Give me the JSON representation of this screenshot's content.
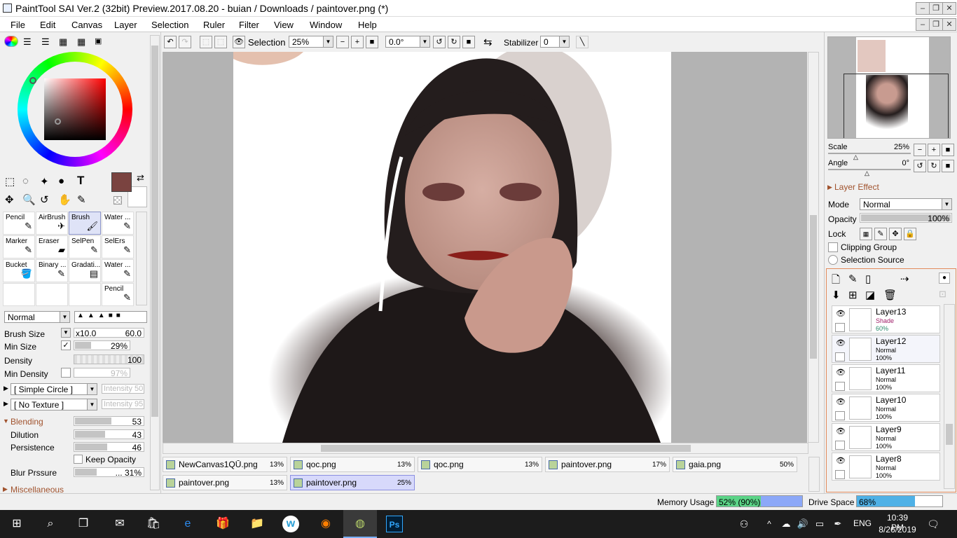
{
  "window": {
    "title": "PaintTool SAI Ver.2 (32bit) Preview.2017.08.20 - buian / Downloads / paintover.png (*)"
  },
  "menu": [
    "File",
    "Edit",
    "Canvas",
    "Layer",
    "Selection",
    "Ruler",
    "Filter",
    "View",
    "Window",
    "Help"
  ],
  "toolbar": {
    "selection_label": "Selection",
    "zoom_value": "25%",
    "angle_value": "0.0°",
    "stabilizer_label": "Stabilizer",
    "stabilizer_value": "0"
  },
  "tools": {
    "grid": [
      {
        "label": "Pencil",
        "icon": "✎"
      },
      {
        "label": "AirBrush",
        "icon": "✈"
      },
      {
        "label": "Brush",
        "icon": "🖌",
        "selected": true
      },
      {
        "label": "Water ...",
        "icon": "✎"
      },
      {
        "label": "Marker",
        "icon": "✎"
      },
      {
        "label": "Eraser",
        "icon": "▰"
      },
      {
        "label": "SelPen",
        "icon": "✎"
      },
      {
        "label": "SelErs",
        "icon": "✎"
      },
      {
        "label": "Bucket",
        "icon": "🪣"
      },
      {
        "label": "Binary ...",
        "icon": "✎"
      },
      {
        "label": "Gradati...",
        "icon": "▤"
      },
      {
        "label": "Water ...",
        "icon": "✎"
      },
      {
        "label": "",
        "icon": ""
      },
      {
        "label": "",
        "icon": ""
      },
      {
        "label": "",
        "icon": ""
      },
      {
        "label": "Pencil",
        "icon": "✎"
      }
    ]
  },
  "brush": {
    "blend_mode": "Normal",
    "size_label": "Brush Size",
    "size_mult": "x10.0",
    "size_value": "60.0",
    "min_size_label": "Min Size",
    "min_size_value": "29%",
    "min_size_fill": 0.29,
    "density_label": "Density",
    "density_value": "100",
    "min_density_label": "Min Density",
    "min_density_value": "97%",
    "shape": "[ Simple Circle ]",
    "shape_intensity": "Intensity 50",
    "texture": "[ No Texture ]",
    "texture_intensity": "Intensity 95",
    "blending_label": "Blending",
    "blending_value": "53",
    "blending_fill": 0.53,
    "dilution_label": "Dilution",
    "dilution_value": "43",
    "dilution_fill": 0.43,
    "persistence_label": "Persistence",
    "persistence_value": "46",
    "persistence_fill": 0.46,
    "keep_opacity_label": "Keep Opacity",
    "blur_label": "Blur Prssure",
    "blur_value": "... 31%",
    "blur_fill": 0.31,
    "misc_label": "Miscellaneous"
  },
  "colors": {
    "primary": "#7a4340",
    "accent_select": "#dfe3f7",
    "doctab_sel": "#d7d9fb"
  },
  "doc_tabs": [
    {
      "name": "NewCanvas1QŪ.png",
      "pct": "13%"
    },
    {
      "name": "qoc.png",
      "pct": "13%"
    },
    {
      "name": "qoc.png",
      "pct": "13%"
    },
    {
      "name": "paintover.png",
      "pct": "17%"
    },
    {
      "name": "gaia.png",
      "pct": "50%"
    },
    {
      "name": "paintover.png",
      "pct": "13%"
    },
    {
      "name": "paintover.png",
      "pct": "25%",
      "selected": true
    }
  ],
  "navigator": {
    "scale_label": "Scale",
    "scale_value": "25%",
    "angle_label": "Angle",
    "angle_value": "0°"
  },
  "layer_panel": {
    "effect_label": "Layer Effect",
    "mode_label": "Mode",
    "mode_value": "Normal",
    "opacity_label": "Opacity",
    "opacity_value": "100%",
    "lock_label": "Lock",
    "clipping_label": "Clipping Group",
    "selection_source_label": "Selection Source",
    "layers": [
      {
        "name": "Layer13",
        "mode": "Shade",
        "opacity": "60%"
      },
      {
        "name": "Layer12",
        "mode": "Normal",
        "opacity": "100%"
      },
      {
        "name": "Layer11",
        "mode": "Normal",
        "opacity": "100%"
      },
      {
        "name": "Layer10",
        "mode": "Normal",
        "opacity": "100%"
      },
      {
        "name": "Layer9",
        "mode": "Normal",
        "opacity": "100%"
      },
      {
        "name": "Layer8",
        "mode": "Normal",
        "opacity": "100%"
      }
    ]
  },
  "status": {
    "memory_label": "Memory Usage",
    "memory_value": "52% (90%)",
    "memory_fill": 0.52,
    "drive_label": "Drive Space",
    "drive_value": "68%",
    "drive_fill": 0.68
  },
  "taskbar": {
    "lang": "ENG",
    "time": "10:39 PM",
    "date": "8/26/2019"
  }
}
